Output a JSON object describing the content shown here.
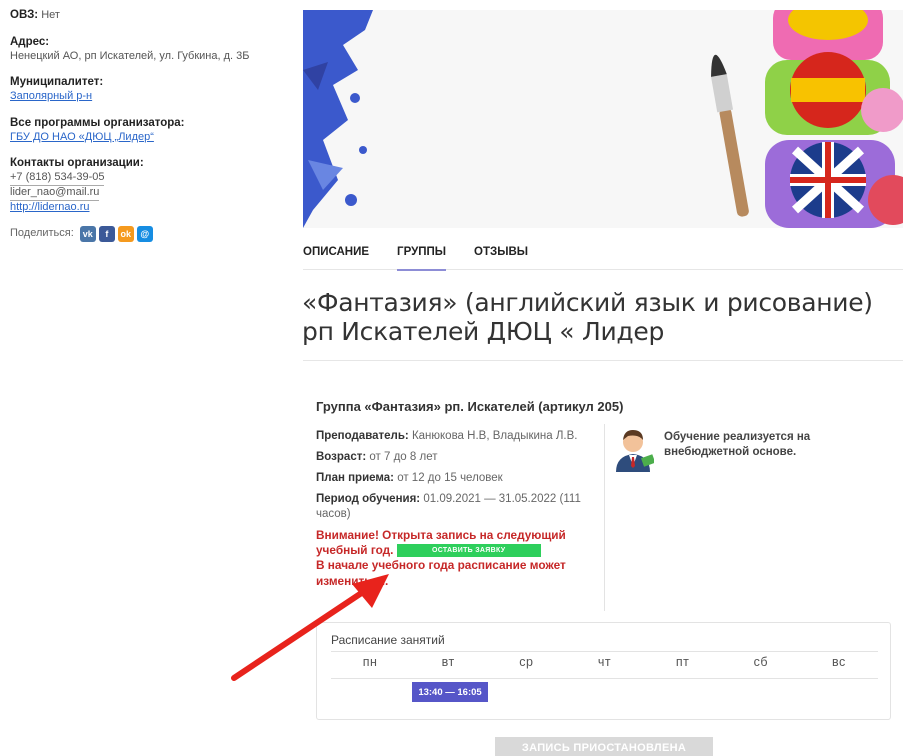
{
  "sidebar": {
    "ovz_label": "ОВЗ:",
    "ovz_value": "Нет",
    "address_label": "Адрес:",
    "address_value": "Ненецкий АО, рп Искателей, ул. Губкина, д. 3Б",
    "municipality_label": "Муниципалитет:",
    "municipality_link": "Заполярный р-н",
    "programs_label": "Все программы организатора:",
    "programs_link": "ГБУ ДО НАО «ДЮЦ „Лидер“",
    "contacts_label": "Контакты организации:",
    "phone": "+7 (818) 534-39-05",
    "email": "lider_nao@mail.ru",
    "website": "http://lidernao.ru",
    "share_label": "Поделиться:"
  },
  "share_icons": [
    "vk-icon",
    "facebook-icon",
    "odnoklassniki-icon",
    "moimir-icon"
  ],
  "tabs": [
    {
      "label": "ОПИСАНИЕ",
      "active": false
    },
    {
      "label": "ГРУППЫ",
      "active": true
    },
    {
      "label": "ОТЗЫВЫ",
      "active": false
    }
  ],
  "title": "«Фантазия» (английский язык и рисование) рп Искателей ДЮЦ « Лидер",
  "group": {
    "heading": "Группа «Фантазия» рп. Искателей (артикул 205)",
    "teacher_label": "Преподаватель:",
    "teacher_value": "Канюкова Н.В, Владыкина Л.В.",
    "age_label": "Возраст:",
    "age_value": "от 7 до 8 лет",
    "plan_label": "План приема:",
    "plan_value": "от 12 до 15 человек",
    "period_label": "Период обучения:",
    "period_value": "01.09.2021 — 31.05.2022 (111 часов)",
    "warning_1": "Внимание! Открыта запись на следующий учебный год.",
    "apply_button": "ОСТАВИТЬ ЗАЯВКУ",
    "warning_2": "В начале учебного года расписание может измениться.",
    "funding_text": "Обучение реализуется на внебюджетной основе."
  },
  "schedule": {
    "heading": "Расписание занятий",
    "days": [
      "пн",
      "вт",
      "ср",
      "чт",
      "пт",
      "сб",
      "вс"
    ],
    "slot": "13:40 — 16:05"
  },
  "paused_button": "ЗАПИСЬ ПРИОСТАНОВЛЕНА",
  "colors": {
    "link": "#2a66c9",
    "warning": "#c62828",
    "apply": "#2ecf5c",
    "slot": "#5656c8",
    "tab_underline": "#8d8dd6",
    "arrow": "#e8231c"
  }
}
